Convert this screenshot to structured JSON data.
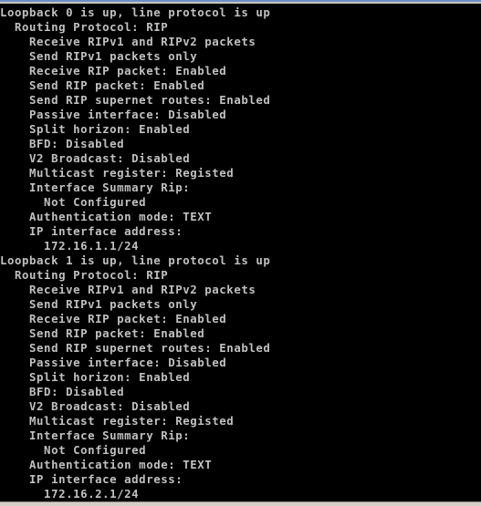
{
  "colors": {
    "background": "#000000",
    "text": "#c0c0c0"
  },
  "lines": [
    "Loopback 0 is up, line protocol is up",
    "  Routing Protocol: RIP",
    "    Receive RIPv1 and RIPv2 packets",
    "    Send RIPv1 packets only",
    "    Receive RIP packet: Enabled",
    "    Send RIP packet: Enabled",
    "    Send RIP supernet routes: Enabled",
    "    Passive interface: Disabled",
    "    Split horizon: Enabled",
    "    BFD: Disabled",
    "    V2 Broadcast: Disabled",
    "    Multicast register: Registed",
    "    Interface Summary Rip:",
    "      Not Configured",
    "    Authentication mode: TEXT",
    "    IP interface address:",
    "      172.16.1.1/24",
    "Loopback 1 is up, line protocol is up",
    "  Routing Protocol: RIP",
    "    Receive RIPv1 and RIPv2 packets",
    "    Send RIPv1 packets only",
    "    Receive RIP packet: Enabled",
    "    Send RIP packet: Enabled",
    "    Send RIP supernet routes: Enabled",
    "    Passive interface: Disabled",
    "    Split horizon: Enabled",
    "    BFD: Disabled",
    "    V2 Broadcast: Disabled",
    "    Multicast register: Registed",
    "    Interface Summary Rip:",
    "      Not Configured",
    "    Authentication mode: TEXT",
    "    IP interface address:",
    "      172.16.2.1/24"
  ]
}
